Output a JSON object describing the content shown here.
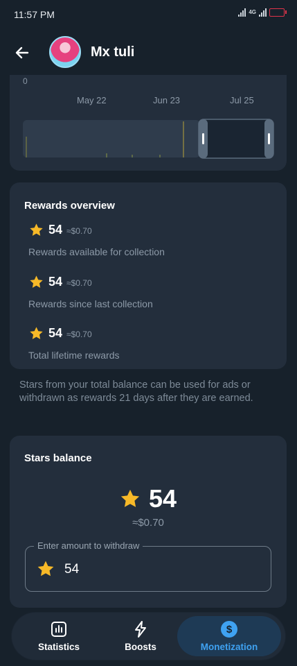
{
  "status_bar": {
    "time": "11:57 PM",
    "network": "4G"
  },
  "header": {
    "title": "Mx tuli"
  },
  "chart": {
    "y_zero_label": "0",
    "x_ticks": [
      "May 22",
      "Jun 23",
      "Jul 25"
    ]
  },
  "rewards": {
    "title": "Rewards overview",
    "items": [
      {
        "stars": "54",
        "usd": "≈$0.70",
        "label": "Rewards available for collection"
      },
      {
        "stars": "54",
        "usd": "≈$0.70",
        "label": "Rewards since last collection"
      },
      {
        "stars": "54",
        "usd": "≈$0.70",
        "label": "Total lifetime rewards"
      }
    ]
  },
  "note": "Stars from your total balance can be used for ads or withdrawn as rewards 21 days after they are earned.",
  "balance": {
    "title": "Stars balance",
    "stars": "54",
    "usd": "≈$0.70",
    "withdraw_label": "Enter amount to withdraw",
    "withdraw_value": "54"
  },
  "tabs": [
    {
      "label": "Statistics",
      "icon": "chart-icon"
    },
    {
      "label": "Boosts",
      "icon": "lightning-icon"
    },
    {
      "label": "Monetization",
      "icon": "dollar-icon",
      "active": true
    }
  ],
  "colors": {
    "accent": "#3fa2f2",
    "star": "#f7b928",
    "background": "#17212b",
    "card": "#232e3c"
  }
}
